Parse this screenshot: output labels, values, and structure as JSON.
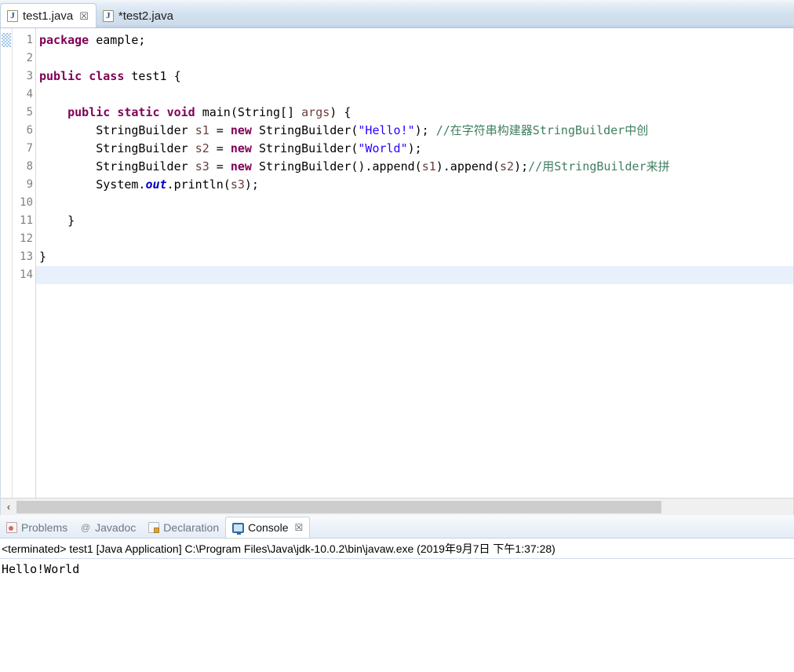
{
  "editor_tabs": [
    {
      "label": "test1.java",
      "icon": "java-file-icon",
      "close": "☒",
      "active": true
    },
    {
      "label": "*test2.java",
      "icon": "java-file-icon",
      "close": "",
      "active": false
    }
  ],
  "gutter": {
    "lines": [
      "1",
      "2",
      "3",
      "4",
      "5",
      "6",
      "7",
      "8",
      "9",
      "10",
      "11",
      "12",
      "13",
      "14"
    ],
    "fold_marker_line": "5"
  },
  "code": {
    "lines": [
      {
        "n": "1",
        "tokens": [
          {
            "t": "package ",
            "c": "kw"
          },
          {
            "t": "eample;",
            "c": "plain"
          }
        ]
      },
      {
        "n": "2",
        "tokens": [
          {
            "t": "",
            "c": "plain"
          }
        ]
      },
      {
        "n": "3",
        "tokens": [
          {
            "t": "public ",
            "c": "kw"
          },
          {
            "t": "class ",
            "c": "kw"
          },
          {
            "t": "test1 {",
            "c": "plain"
          }
        ]
      },
      {
        "n": "4",
        "tokens": [
          {
            "t": "",
            "c": "plain"
          }
        ]
      },
      {
        "n": "5",
        "tokens": [
          {
            "t": "    ",
            "c": "plain"
          },
          {
            "t": "public ",
            "c": "kw"
          },
          {
            "t": "static ",
            "c": "kw"
          },
          {
            "t": "void ",
            "c": "kw"
          },
          {
            "t": "main(String[] ",
            "c": "plain"
          },
          {
            "t": "args",
            "c": "loc"
          },
          {
            "t": ") {",
            "c": "plain"
          }
        ]
      },
      {
        "n": "6",
        "tokens": [
          {
            "t": "        StringBuilder ",
            "c": "plain"
          },
          {
            "t": "s1",
            "c": "loc"
          },
          {
            "t": " = ",
            "c": "plain"
          },
          {
            "t": "new ",
            "c": "kw"
          },
          {
            "t": "StringBuilder(",
            "c": "plain"
          },
          {
            "t": "\"Hello!\"",
            "c": "str"
          },
          {
            "t": "); ",
            "c": "plain"
          },
          {
            "t": "//在字符串构建器StringBuilder中创",
            "c": "cmt"
          }
        ]
      },
      {
        "n": "7",
        "tokens": [
          {
            "t": "        StringBuilder ",
            "c": "plain"
          },
          {
            "t": "s2",
            "c": "loc"
          },
          {
            "t": " = ",
            "c": "plain"
          },
          {
            "t": "new ",
            "c": "kw"
          },
          {
            "t": "StringBuilder(",
            "c": "plain"
          },
          {
            "t": "\"World\"",
            "c": "str"
          },
          {
            "t": ");",
            "c": "plain"
          }
        ]
      },
      {
        "n": "8",
        "tokens": [
          {
            "t": "        StringBuilder ",
            "c": "plain"
          },
          {
            "t": "s3",
            "c": "loc"
          },
          {
            "t": " = ",
            "c": "plain"
          },
          {
            "t": "new ",
            "c": "kw"
          },
          {
            "t": "StringBuilder().append(",
            "c": "plain"
          },
          {
            "t": "s1",
            "c": "loc"
          },
          {
            "t": ").append(",
            "c": "plain"
          },
          {
            "t": "s2",
            "c": "loc"
          },
          {
            "t": ");",
            "c": "plain"
          },
          {
            "t": "//用StringBuilder来拼",
            "c": "cmt"
          }
        ]
      },
      {
        "n": "9",
        "tokens": [
          {
            "t": "        System.",
            "c": "plain"
          },
          {
            "t": "out",
            "c": "fld"
          },
          {
            "t": ".println(",
            "c": "plain"
          },
          {
            "t": "s3",
            "c": "loc"
          },
          {
            "t": ");",
            "c": "plain"
          }
        ]
      },
      {
        "n": "10",
        "tokens": [
          {
            "t": "",
            "c": "plain"
          }
        ]
      },
      {
        "n": "11",
        "tokens": [
          {
            "t": "    }",
            "c": "plain"
          }
        ]
      },
      {
        "n": "12",
        "tokens": [
          {
            "t": "",
            "c": "plain"
          }
        ]
      },
      {
        "n": "13",
        "tokens": [
          {
            "t": "}",
            "c": "plain"
          }
        ]
      },
      {
        "n": "14",
        "tokens": [
          {
            "t": "",
            "c": "plain"
          }
        ],
        "current": true
      }
    ]
  },
  "hscroll": {
    "left_arrow": "‹"
  },
  "view_tabs": [
    {
      "label": "Problems",
      "icon": "problems-icon",
      "active": false,
      "close": ""
    },
    {
      "label": "Javadoc",
      "icon": "javadoc-icon",
      "active": false,
      "close": ""
    },
    {
      "label": "Declaration",
      "icon": "declaration-icon",
      "active": false,
      "close": ""
    },
    {
      "label": "Console",
      "icon": "console-icon",
      "active": true,
      "close": "☒"
    }
  ],
  "console": {
    "status": "<terminated> test1 [Java Application] C:\\Program Files\\Java\\jdk-10.0.2\\bin\\javaw.exe (2019年9月7日 下午1:37:28)",
    "output": "Hello!World"
  },
  "colors": {
    "keyword": "#7f0055",
    "string": "#2a00ff",
    "comment": "#3f7f5f",
    "field": "#0000c0",
    "local_var": "#6a3e3e",
    "current_line": "#e8f0fb",
    "tabbar": "#d3e0ee"
  }
}
